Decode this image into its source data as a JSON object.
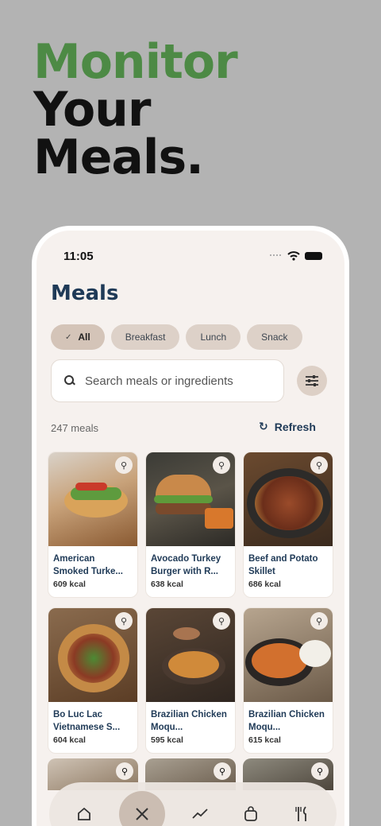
{
  "headline": {
    "line1": "Monitor",
    "line2": "Your",
    "line3": "Meals."
  },
  "status": {
    "time": "11:05"
  },
  "page": {
    "title": "Meals"
  },
  "filters": [
    {
      "label": "All",
      "active": true
    },
    {
      "label": "Breakfast",
      "active": false
    },
    {
      "label": "Lunch",
      "active": false
    },
    {
      "label": "Snack",
      "active": false
    }
  ],
  "search": {
    "placeholder": "Search meals or ingredients"
  },
  "summary": {
    "count": "247 meals",
    "refresh_label": "Refresh"
  },
  "meals": [
    {
      "name": "American Smoked Turke...",
      "kcal": "609 kcal"
    },
    {
      "name": "Avocado Turkey Burger with R...",
      "kcal": "638 kcal"
    },
    {
      "name": "Beef and Potato Skillet",
      "kcal": "686 kcal"
    },
    {
      "name": "Bo Luc Lac Vietnamese S...",
      "kcal": "604 kcal"
    },
    {
      "name": "Brazilian Chicken Moqu...",
      "kcal": "595 kcal"
    },
    {
      "name": "Brazilian Chicken Moqu...",
      "kcal": "615 kcal"
    }
  ],
  "colors": {
    "accent_green": "#4d8a45",
    "navy": "#1f3a57",
    "chip": "#ddd1c8"
  },
  "tabs": [
    "home-icon",
    "utensils-icon",
    "trend-icon",
    "bag-icon",
    "fork-knife-icon"
  ]
}
